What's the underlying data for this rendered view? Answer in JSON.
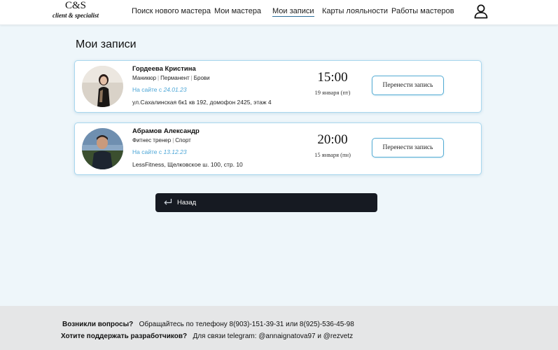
{
  "logo": {
    "main": "C&S",
    "sub": "client & specialist"
  },
  "nav": [
    {
      "label": "Поиск нового мастера",
      "active": false
    },
    {
      "label": "Мои мастера",
      "active": false
    },
    {
      "label": "Мои записи",
      "active": true
    },
    {
      "label": "Карты лояльности",
      "active": false
    },
    {
      "label": "Работы мастеров",
      "active": false
    }
  ],
  "page_title": "Мои записи",
  "appointments": [
    {
      "name": "Гордеева Кристина",
      "categories": [
        "Маникюр",
        "Перманент",
        "Брови"
      ],
      "since_label": "На сайте с ",
      "since_date": "24.01.23",
      "address": "ул.Сахалинская 6к1 кв 192, домофон 2425, этаж 4",
      "time": "15:00",
      "date": "19 января (пт)",
      "button": "Перенести запись"
    },
    {
      "name": "Абрамов Александр",
      "categories": [
        "Фитнес тренер",
        "Спорт"
      ],
      "since_label": "На сайте с ",
      "since_date": "13.12.23",
      "address": "LessFitness, Щелковское ш. 100, стр. 10",
      "time": "20:00",
      "date": "15 января (пн)",
      "button": "Перенести запись"
    }
  ],
  "back_button": "Назад",
  "footer": {
    "q1": "Возникли вопросы?",
    "a1": "Обращайтесь по телефону 8(903)-151-39-31 или 8(925)-536-45-98",
    "q2": "Хотите поддержать разработчиков?",
    "a2": "Для связи telegram: @annaignatova97 и @rezvetz"
  },
  "colors": {
    "accent": "#4aa5d6",
    "card_border": "#a9d7ee",
    "background": "#eef6fa",
    "dark_button": "#161a22"
  }
}
